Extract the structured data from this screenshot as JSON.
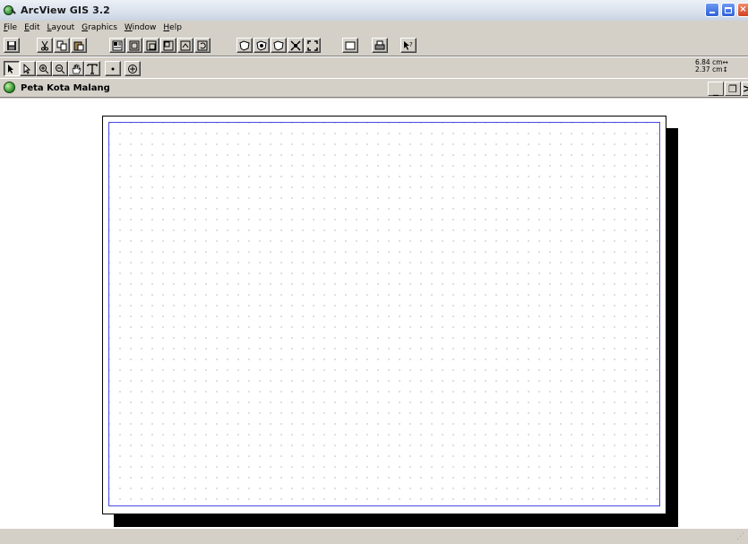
{
  "app": {
    "title": "ArcView GIS 3.2"
  },
  "menu": [
    "File",
    "Edit",
    "Layout",
    "Graphics",
    "Window",
    "Help"
  ],
  "toolbar_buttons": [
    "save-icon",
    "cut-icon",
    "copy-icon",
    "paste-icon",
    "properties-icon",
    "frame-icon",
    "frame-icon",
    "frame-icon",
    "frame-icon",
    "undo-icon",
    "map-icon",
    "map-icon",
    "map-icon",
    "zoom-extent-icon",
    "zoom-fit-icon",
    "page-icon",
    "print-icon",
    "help-icon"
  ],
  "tools": [
    "pointer-icon",
    "vertex-icon",
    "zoom-in-icon",
    "zoom-out-icon",
    "pan-icon",
    "text-icon",
    "point-icon",
    "symbol-icon"
  ],
  "measure": {
    "x": "6.84 cm↔",
    "y": "2.37 cm↕"
  },
  "document": {
    "title": "Peta Kota Malang"
  }
}
